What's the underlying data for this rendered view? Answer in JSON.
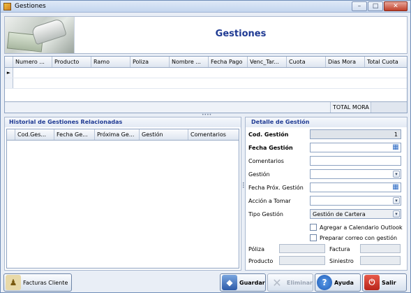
{
  "window": {
    "title": "Gestiones",
    "controls": [
      "minimize",
      "maximize",
      "close"
    ]
  },
  "header": {
    "title": "Gestiones"
  },
  "policies_grid": {
    "columns": [
      "Numero ...",
      "Producto",
      "Ramo",
      "Poliza",
      "Nombre ...",
      "Fecha Pago",
      "Venc_Tar...",
      "Cuota",
      "Dias Mora",
      "Total Cuota"
    ],
    "new_row_marker": "►",
    "total_label": "TOTAL MORA",
    "total_value": ""
  },
  "history": {
    "title": "Historial de Gestiones Relacionadas",
    "columns": [
      "Cod.Ges...",
      "Fecha Ge...",
      "Próxima Ge...",
      "Gestión",
      "Comentarios"
    ]
  },
  "detail": {
    "title": "Detalle de Gestión",
    "cod_gestion": {
      "label": "Cod. Gestión",
      "value": "1"
    },
    "fecha_gestion": {
      "label": "Fecha Gestión",
      "value": ""
    },
    "comentarios": {
      "label": "Comentarios",
      "value": ""
    },
    "gestion": {
      "label": "Gestión",
      "value": ""
    },
    "fecha_prox_gestion": {
      "label": "Fecha Próx. Gestión",
      "value": ""
    },
    "accion_tomar": {
      "label": "Acción a Tomar",
      "value": ""
    },
    "tipo_gestion": {
      "label": "Tipo Gestión",
      "value": "Gestión de Cartera"
    },
    "agregar_calendario": {
      "label": "Agregar a Calendario Outlook",
      "checked": false
    },
    "preparar_correo": {
      "label": "Preparar correo con gestión",
      "checked": false
    },
    "poliza": {
      "label": "Póliza",
      "value": ""
    },
    "factura": {
      "label": "Factura",
      "value": ""
    },
    "producto": {
      "label": "Producto",
      "value": ""
    },
    "siniestro": {
      "label": "Siniestro",
      "value": ""
    }
  },
  "buttons": {
    "facturas_cliente": "Facturas Cliente",
    "guardar": "Guardar",
    "eliminar": "Eliminar",
    "ayuda": "Ayuda",
    "salir": "Salir"
  },
  "icons": {
    "app": "app-icon",
    "calendar": "calendar-icon",
    "dropdown": "chevron-down-icon"
  }
}
